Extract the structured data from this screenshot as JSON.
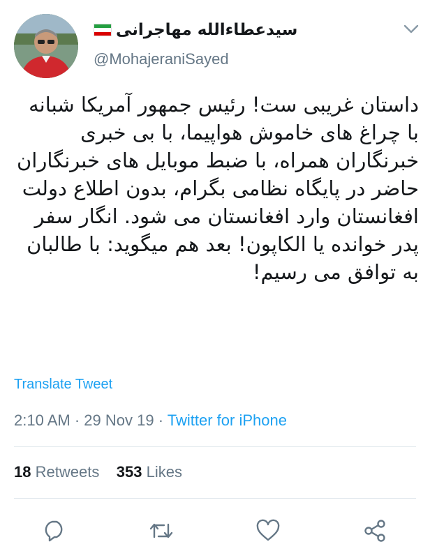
{
  "user": {
    "display_name": "سیدعطاءالله مهاجرانی",
    "handle": "@MohajeraniSayed",
    "avatar_icon": "avatar-photo",
    "flag_icon": "iran-flag-icon"
  },
  "tweet": {
    "text": "داستان غریبی ست! رئیس جمهور آمریکا شبانه با چراغ های خاموش هواپیما، با بی خبری خبرنگاران همراه، با ضبط موبایل های خبرنگاران حاضر در پایگاه نظامی بگرام، بدون اطلاع دولت افغانستان وارد افغانستان می شود. انگار سفر پدر خوانده یا الکاپون! بعد هم میگوید: با طالبان به توافق می رسیم!",
    "translate_label": "Translate Tweet",
    "time": "2:10 AM",
    "separator": "·",
    "date": "29 Nov 19",
    "source": "Twitter for iPhone"
  },
  "stats": {
    "retweets_count": "18",
    "retweets_label": "Retweets",
    "likes_count": "353",
    "likes_label": "Likes"
  },
  "actions": [
    "reply-icon",
    "retweet-icon",
    "like-icon",
    "share-icon"
  ],
  "colors": {
    "link": "#1da1f2",
    "muted": "#657786",
    "text": "#14171a",
    "divider": "#e1e8ed"
  }
}
